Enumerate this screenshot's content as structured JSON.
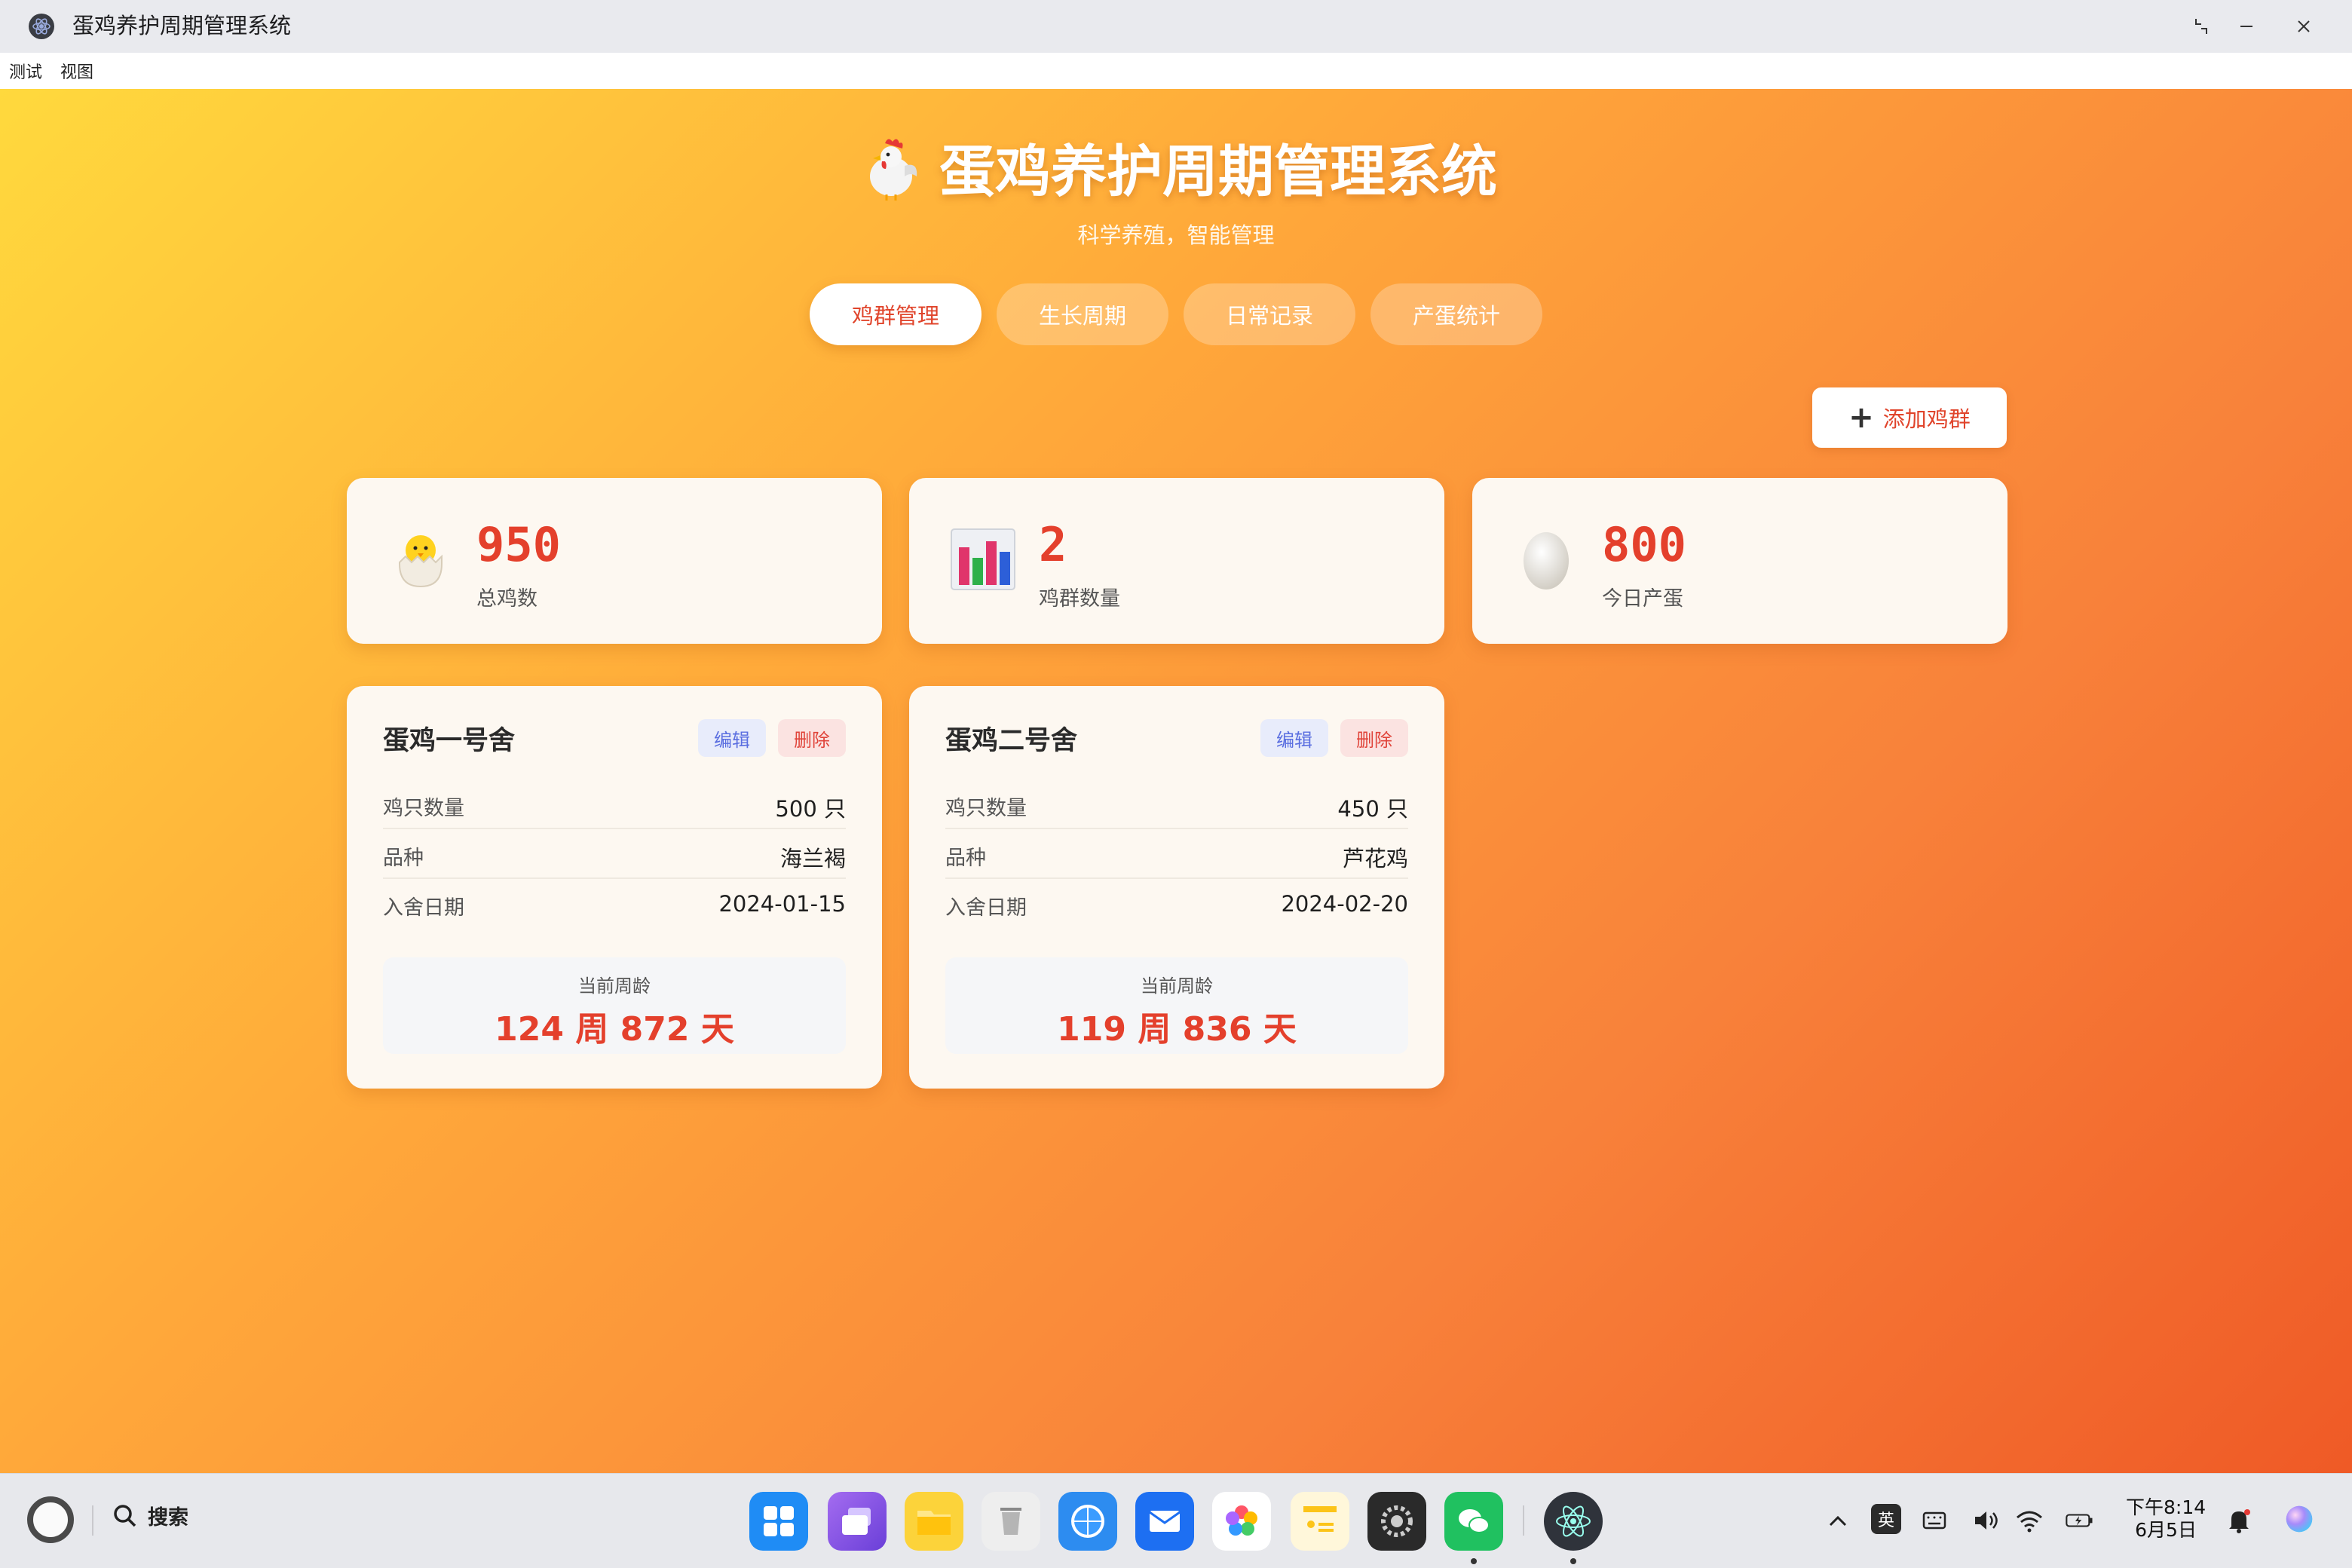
{
  "window": {
    "title": "蛋鸡养护周期管理系统"
  },
  "menu": {
    "items": [
      "测试",
      "视图"
    ]
  },
  "header": {
    "title": "蛋鸡养护周期管理系统",
    "subtitle": "科学养殖，智能管理",
    "title_icon": "rooster-icon"
  },
  "tabs": [
    {
      "label": "鸡群管理",
      "active": true
    },
    {
      "label": "生长周期",
      "active": false
    },
    {
      "label": "日常记录",
      "active": false
    },
    {
      "label": "产蛋统计",
      "active": false
    }
  ],
  "add_button": {
    "icon": "plus-icon",
    "label": "添加鸡群"
  },
  "stats": [
    {
      "icon": "hatching-chick-icon",
      "value": "950",
      "label": "总鸡数"
    },
    {
      "icon": "bar-chart-icon",
      "value": "2",
      "label": "鸡群数量"
    },
    {
      "icon": "egg-icon",
      "value": "800",
      "label": "今日产蛋"
    }
  ],
  "flocks": [
    {
      "name": "蛋鸡一号舍",
      "edit_label": "编辑",
      "delete_label": "删除",
      "rows": [
        {
          "key": "鸡只数量",
          "value": "500 只"
        },
        {
          "key": "品种",
          "value": "海兰褐"
        },
        {
          "key": "入舍日期",
          "value": "2024-01-15"
        }
      ],
      "age_label": "当前周龄",
      "age_value": "124 周 872 天"
    },
    {
      "name": "蛋鸡二号舍",
      "edit_label": "编辑",
      "delete_label": "删除",
      "rows": [
        {
          "key": "鸡只数量",
          "value": "450 只"
        },
        {
          "key": "品种",
          "value": "芦花鸡"
        },
        {
          "key": "入舍日期",
          "value": "2024-02-20"
        }
      ],
      "age_label": "当前周龄",
      "age_value": "119 周 836 天"
    }
  ],
  "taskbar": {
    "search_label": "搜索",
    "ime_label": "英",
    "time": "下午8:14",
    "date": "6月5日",
    "apps": [
      "launcher-grid-icon",
      "multitask-icon",
      "files-icon",
      "trash-icon",
      "browser-icon",
      "mail-icon",
      "photos-icon",
      "notes-icon",
      "settings-icon",
      "wechat-icon",
      "electron-app-icon"
    ]
  },
  "colors": {
    "accent_red": "#e4402c",
    "gradient_start": "#ffd93d",
    "gradient_end": "#ef5a26",
    "card_bg": "#fdf8f1"
  }
}
